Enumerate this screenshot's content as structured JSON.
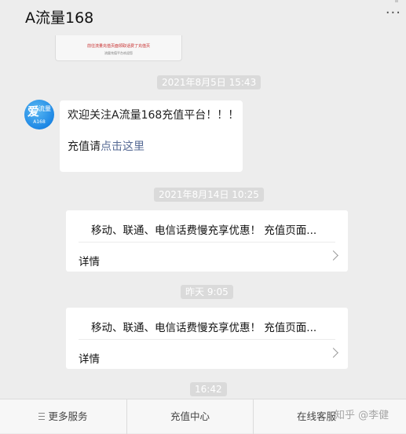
{
  "header": {
    "title": "A流量168",
    "more_icon": "more-icon"
  },
  "preview": {
    "text": "前往流量充值页面领取话费了充值页",
    "subtext": "流量充值平台欢迎您"
  },
  "timestamps": [
    "2021年8月5日 15:43",
    "2021年8月14日 10:25",
    "昨天 9:05",
    "16:42"
  ],
  "avatar": {
    "glyph": "爱",
    "side": "流量",
    "bottom": "A168"
  },
  "message": {
    "line1": "欢迎关注A流量168充值平台！！！",
    "line2_prefix": "充值请",
    "line2_link": "点击这里"
  },
  "cards": [
    {
      "headline": "移动、联通、电信话费慢充享优惠！    充值页面...",
      "detail": "详情"
    },
    {
      "headline": "移动、联通、电信话费慢充享优惠！    充值页面...",
      "detail": "详情"
    }
  ],
  "bottom_menu": {
    "items": [
      {
        "label": "更多服务"
      },
      {
        "label": "充值中心"
      },
      {
        "label": "在线客服"
      }
    ]
  },
  "watermark": "知乎 @李健"
}
